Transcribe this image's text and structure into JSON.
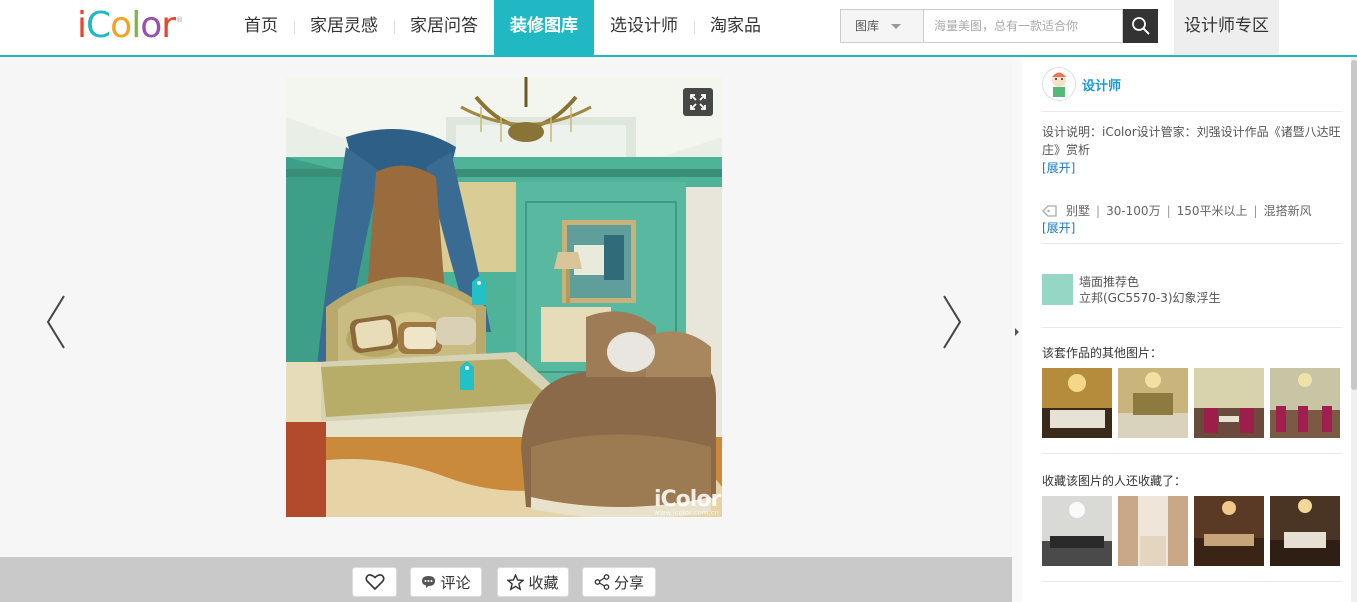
{
  "header": {
    "logo_letters": [
      "i",
      "C",
      "o",
      "l",
      "o",
      "r"
    ],
    "logo_colors": [
      "#e8452c",
      "#1fb8c3",
      "#f3a31d",
      "#7ab93f",
      "#9b4fb3",
      "#e8452c"
    ],
    "logo_mark": "®",
    "nav": [
      "首页",
      "家居灵感",
      "家居问答",
      "装修图库",
      "选设计师",
      "淘家品"
    ],
    "active_nav": "装修图库",
    "search_category": "图库",
    "search_placeholder": "海量美图，总有一款适合你",
    "designer_zone": "设计师专区",
    "accent": "#1fb8c3"
  },
  "viewer": {
    "watermark": "iColor",
    "watermark_url": "www.icolor.com.cn",
    "icons": [
      "arrow-left-icon",
      "arrow-right-icon",
      "fullscreen-icon",
      "tag-pin-icon"
    ]
  },
  "actions": {
    "comment": "评论",
    "collect": "收藏",
    "share": "分享"
  },
  "sidebar": {
    "designer_name": "设计师",
    "description": "设计说明：iColor设计管家：刘强设计作品《诸暨八达旺庄》赏析",
    "expand": "[展开]",
    "tags": [
      "别墅",
      "30-100万",
      "150平米以上",
      "混搭新风"
    ],
    "wall_color_title": "墙面推荐色",
    "wall_color_name": "立邦(GC5570-3)幻象浮生",
    "wall_color_hex": "#96d6c4",
    "other_images_title": "该套作品的其他图片：",
    "also_collected_title": "收藏该图片的人还收藏了："
  }
}
